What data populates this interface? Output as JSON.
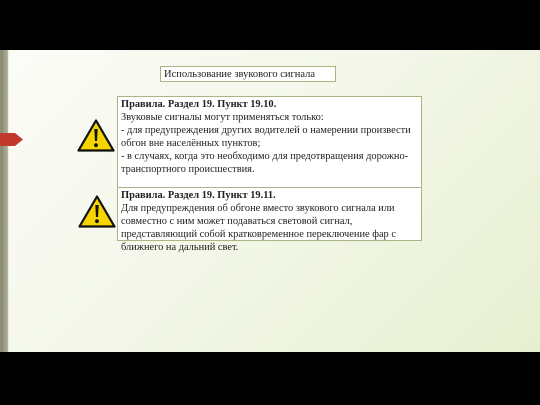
{
  "slide": {
    "title": "Использование звукового сигнала"
  },
  "rules": [
    {
      "heading": "Правила. Раздел 19. Пункт 19.10.",
      "lines": [
        "Звуковые сигналы могут применяться только:",
        "- для предупреждения других водителей о намерении произвести обгон вне населённых пунктов;",
        "- в случаях, когда это необходимо для предотвращения дорожно-транспортного происшествия."
      ]
    },
    {
      "heading": "Правила. Раздел 19. Пункт 19.11.",
      "lines": [
        "Для предупреждения об обгоне вместо звукового сигнала или совместно с ним может подаваться световой сигнал, представляющий собой кратковременное переключение фар с ближнего на дальний свет."
      ]
    }
  ],
  "colors": {
    "box_border": "#a9b684",
    "accent_arrow": "#c0392b",
    "warning_fill": "#f5d400"
  },
  "icons": [
    "warning-triangle-icon",
    "red-arrow-icon"
  ]
}
